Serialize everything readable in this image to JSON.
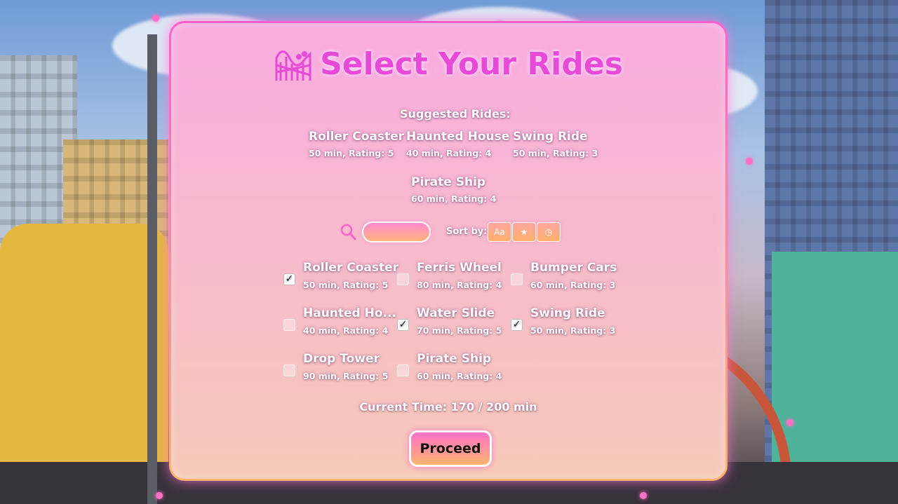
{
  "title": "Select Your Rides",
  "suggested": {
    "label": "Suggested Rides:",
    "items": [
      {
        "name": "Roller Coaster",
        "meta": "50 min, Rating: 5"
      },
      {
        "name": "Haunted House",
        "meta": "40 min, Rating: 4"
      },
      {
        "name": "Swing Ride",
        "meta": "50 min, Rating: 3"
      },
      {
        "name": "Pirate Ship",
        "meta": "60 min, Rating: 4"
      }
    ]
  },
  "search": {
    "value": "",
    "placeholder": ""
  },
  "sort": {
    "label": "Sort by:",
    "options": [
      {
        "icon": "alphabetical-icon",
        "glyph": "Aa"
      },
      {
        "icon": "star-icon",
        "glyph": "★"
      },
      {
        "icon": "clock-icon",
        "glyph": "◷"
      }
    ]
  },
  "rides": [
    {
      "name": "Roller Coaster",
      "meta": "50 min, Rating: 5",
      "checked": true
    },
    {
      "name": "Ferris Wheel",
      "meta": "80 min, Rating: 4",
      "checked": false
    },
    {
      "name": "Bumper Cars",
      "meta": "60 min, Rating: 3",
      "checked": false
    },
    {
      "name": "Haunted Ho...",
      "meta": "40 min, Rating: 4",
      "checked": false
    },
    {
      "name": "Water Slide",
      "meta": "70 min, Rating: 5",
      "checked": true
    },
    {
      "name": "Swing Ride",
      "meta": "50 min, Rating: 3",
      "checked": true
    },
    {
      "name": "Drop Tower",
      "meta": "90 min, Rating: 5",
      "checked": false
    },
    {
      "name": "Pirate Ship",
      "meta": "60 min, Rating: 4",
      "checked": false
    }
  ],
  "check_glyph": "✓",
  "current_time": "Current Time: 170 / 200 min",
  "proceed_label": "Proceed",
  "colors": {
    "title": "#e84ad8",
    "accent_pink": "#ff72c8",
    "accent_orange": "#ffb46e"
  }
}
